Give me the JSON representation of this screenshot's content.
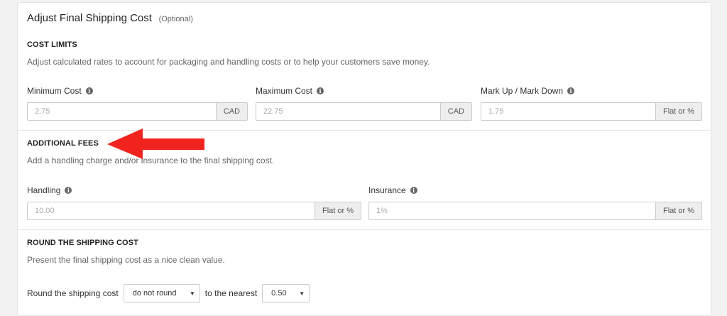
{
  "header": {
    "title": "Adjust Final Shipping Cost",
    "optional": "(Optional)"
  },
  "cost_limits": {
    "title": "COST LIMITS",
    "description": "Adjust calculated rates to account for packaging and handling costs or to help your customers save money.",
    "minimum": {
      "label": "Minimum Cost",
      "placeholder": "2.75",
      "addon": "CAD"
    },
    "maximum": {
      "label": "Maximum Cost",
      "placeholder": "22.75",
      "addon": "CAD"
    },
    "markup": {
      "label": "Mark Up / Mark Down",
      "placeholder": "1.75",
      "addon": "Flat or %"
    }
  },
  "additional_fees": {
    "title": "ADDITIONAL FEES",
    "description": "Add a handling charge and/or insurance to the final shipping cost.",
    "handling": {
      "label": "Handling",
      "placeholder": "10.00",
      "addon": "Flat or %"
    },
    "insurance": {
      "label": "Insurance",
      "placeholder": "1%",
      "addon": "Flat or %"
    }
  },
  "rounding": {
    "title": "ROUND THE SHIPPING COST",
    "description": "Present the final shipping cost as a nice clean value.",
    "prefix": "Round the shipping cost",
    "mode_value": "do not round",
    "middle": "to the nearest",
    "nearest_value": "0.50"
  },
  "icons": {
    "info": "info-icon",
    "caret": "caret-down-icon",
    "annotation": "red-arrow"
  },
  "colors": {
    "annotation_arrow": "#f0231e",
    "addon_bg": "#eeeeee",
    "border": "#cccccc"
  }
}
